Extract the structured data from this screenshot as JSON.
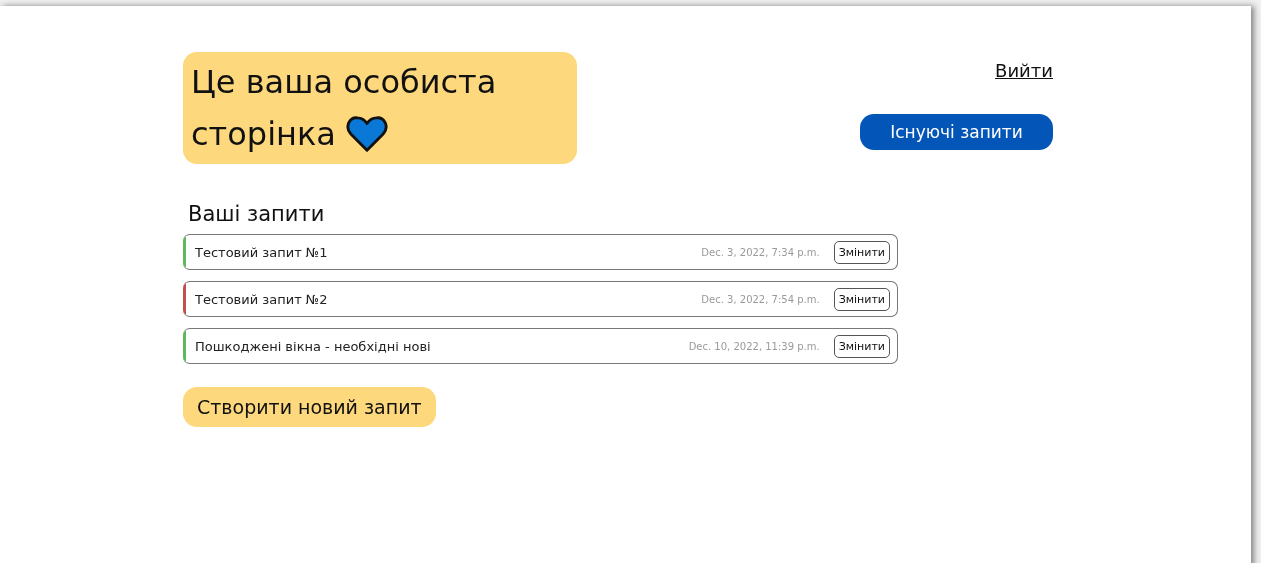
{
  "header": {
    "title": "Це ваша особиста сторінка",
    "logout": "Вийти",
    "existing_button": "Існуючі запити"
  },
  "requests": {
    "heading": "Ваші запити",
    "items": [
      {
        "title": "Тестовий запит №1",
        "date": "Dec. 3, 2022, 7:34 p.m.",
        "action": "Змінити",
        "color": "#5cb85c"
      },
      {
        "title": "Тестовий запит №2",
        "date": "Dec. 3, 2022, 7:54 p.m.",
        "action": "Змінити",
        "color": "#c0504d"
      },
      {
        "title": "Пошкоджені вікна - необхідні нові",
        "date": "Dec. 10, 2022, 11:39 p.m.",
        "action": "Змінити",
        "color": "#5cb85c"
      }
    ]
  },
  "create_button": "Створити новий запит"
}
